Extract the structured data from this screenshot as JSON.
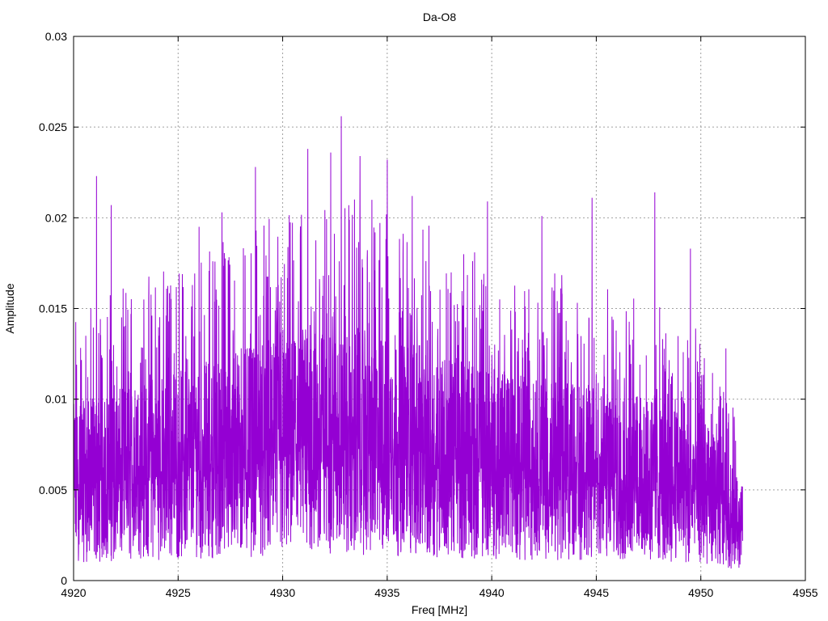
{
  "chart_data": {
    "type": "line",
    "title": "Da-O8",
    "xlabel": "Freq [MHz]",
    "ylabel": "Amplitude",
    "xlim": [
      4920,
      4955
    ],
    "ylim": [
      0,
      0.03
    ],
    "x_ticks": [
      "4920",
      "4925",
      "4930",
      "4935",
      "4940",
      "4945",
      "4950",
      "4955"
    ],
    "y_ticks": [
      "0",
      "0.005",
      "0.01",
      "0.015",
      "0.02",
      "0.025",
      "0.03"
    ],
    "grid": true,
    "legend": "none",
    "series": [
      {
        "color": "#9400d3",
        "x_range": [
          4920.0,
          4952.0
        ],
        "envelope_x": [
          4920,
          4922,
          4924,
          4926,
          4928,
          4930,
          4932,
          4933,
          4934,
          4936,
          4938,
          4940,
          4942,
          4944,
          4946,
          4948,
          4950,
          4951,
          4952
        ],
        "envelope_mid": [
          0.0065,
          0.007,
          0.0075,
          0.008,
          0.0085,
          0.0088,
          0.0092,
          0.0093,
          0.0092,
          0.0088,
          0.0083,
          0.0078,
          0.0075,
          0.0073,
          0.007,
          0.0066,
          0.006,
          0.005,
          0.0035
        ],
        "peaks": [
          {
            "x": 4921.1,
            "y": 0.0223
          },
          {
            "x": 4921.8,
            "y": 0.0207
          },
          {
            "x": 4926.0,
            "y": 0.0195
          },
          {
            "x": 4927.1,
            "y": 0.0203
          },
          {
            "x": 4928.7,
            "y": 0.0228
          },
          {
            "x": 4931.2,
            "y": 0.0238
          },
          {
            "x": 4932.3,
            "y": 0.0236
          },
          {
            "x": 4932.8,
            "y": 0.0256
          },
          {
            "x": 4933.7,
            "y": 0.0234
          },
          {
            "x": 4935.0,
            "y": 0.0232
          },
          {
            "x": 4936.2,
            "y": 0.0212
          },
          {
            "x": 4939.8,
            "y": 0.0209
          },
          {
            "x": 4942.4,
            "y": 0.0201
          },
          {
            "x": 4944.8,
            "y": 0.0211
          },
          {
            "x": 4947.8,
            "y": 0.0214
          },
          {
            "x": 4949.5,
            "y": 0.0183
          },
          {
            "x": 4951.2,
            "y": 0.0128
          }
        ]
      }
    ]
  }
}
